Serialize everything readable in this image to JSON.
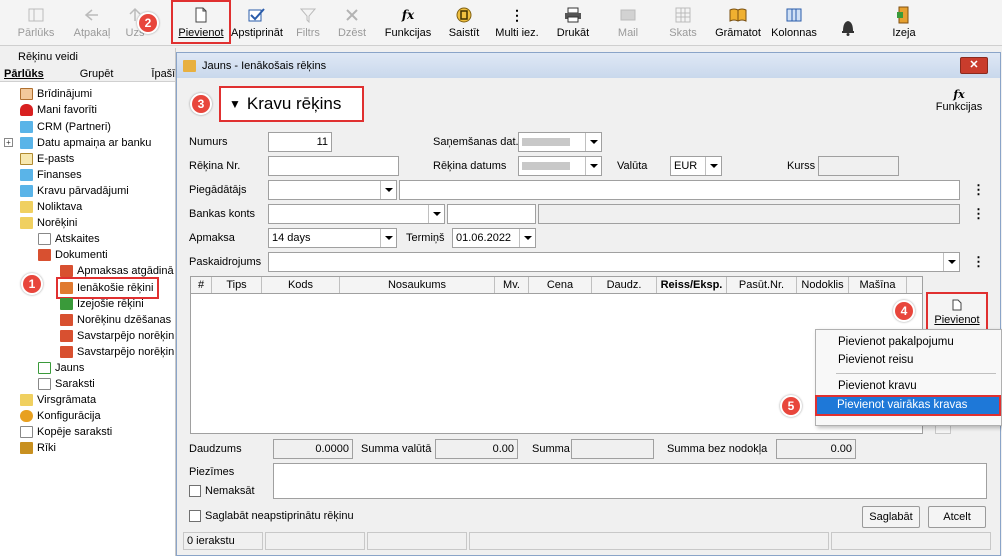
{
  "toolbar": {
    "items": [
      {
        "label": "Pārlūks",
        "icon": "browser-icon",
        "disabled": true
      },
      {
        "label": "Atpakaļ",
        "icon": "back-arrow-icon",
        "disabled": true
      },
      {
        "label": "Uzs",
        "icon": "up-icon",
        "disabled": true
      },
      {
        "label": "Pievienot",
        "icon": "new-document-icon",
        "disabled": false
      },
      {
        "label": "Apstiprināt",
        "icon": "confirm-check-icon",
        "disabled": false
      },
      {
        "label": "Filtrs",
        "icon": "filter-icon",
        "disabled": true
      },
      {
        "label": "Dzēst",
        "icon": "delete-x-icon",
        "disabled": true
      },
      {
        "label": "Funkcijas",
        "icon": "fx-icon",
        "disabled": false
      },
      {
        "label": "Saistīt",
        "icon": "link-icon",
        "disabled": false
      },
      {
        "label": "Multi iez.",
        "icon": "more-vertical-icon",
        "disabled": false
      },
      {
        "label": "Drukāt",
        "icon": "printer-icon",
        "disabled": false
      },
      {
        "label": "Mail",
        "icon": "mail-icon",
        "disabled": true
      },
      {
        "label": "Skats",
        "icon": "grid-view-icon",
        "disabled": true
      },
      {
        "label": "Grāmatot",
        "icon": "book-icon",
        "disabled": false
      },
      {
        "label": "Kolonnas",
        "icon": "columns-icon",
        "disabled": false
      },
      {
        "label": "",
        "icon": "bell-icon",
        "disabled": false
      },
      {
        "label": "Izeja",
        "icon": "exit-door-icon",
        "disabled": false
      }
    ]
  },
  "badges": [
    "1",
    "2",
    "3",
    "4",
    "5"
  ],
  "left_panel": {
    "title": "Rēķinu veidi",
    "tabs": [
      "Pārlūks",
      "Grupēt",
      "Īpašības"
    ],
    "tree": [
      {
        "label": "Brīdinājumi",
        "icon": "home-icon"
      },
      {
        "label": "Mani favorīti",
        "icon": "heart-icon"
      },
      {
        "label": "CRM (Partneri)",
        "icon": "folder-icon"
      },
      {
        "label": "Datu apmaiņa ar banku",
        "icon": "folder-icon"
      },
      {
        "label": "E-pasts",
        "icon": "envelope-icon"
      },
      {
        "label": "Finanses",
        "icon": "folder-icon"
      },
      {
        "label": "Kravu pārvadājumi",
        "icon": "folder-icon"
      },
      {
        "label": "Noliktava",
        "icon": "folder-icon"
      },
      {
        "label": "Norēķini",
        "icon": "folder-icon"
      },
      {
        "label": "Atskaites",
        "icon": "list-icon"
      },
      {
        "label": "Dokumenti",
        "icon": "book-icon"
      },
      {
        "label": "Apmaksas atgādinā",
        "icon": "book-icon"
      },
      {
        "label": "Ienākošie rēķini",
        "icon": "book-icon"
      },
      {
        "label": "Izejošie rēķini",
        "icon": "book-icon"
      },
      {
        "label": "Norēķinu dzēšanas",
        "icon": "book-icon"
      },
      {
        "label": "Savstarpējo norēķin",
        "icon": "book-icon"
      },
      {
        "label": "Savstarpējo norēķin",
        "icon": "book-icon"
      },
      {
        "label": "Jauns",
        "icon": "new-document-icon"
      },
      {
        "label": "Saraksti",
        "icon": "list-icon"
      },
      {
        "label": "Virsgrāmata",
        "icon": "folder-icon"
      },
      {
        "label": "Konfigurācija",
        "icon": "gear-icon"
      },
      {
        "label": "Kopēje saraksti",
        "icon": "list-icon"
      },
      {
        "label": "Rīki",
        "icon": "tools-icon"
      }
    ]
  },
  "window": {
    "title": "Jauns - Ienākošais rēķins",
    "close": "✕",
    "doc_type": "Kravu rēķins",
    "functions_label": "Funkcijas",
    "form": {
      "numurs_label": "Numurs",
      "numurs_value": "11",
      "sanemsanas_label": "Saņemšanas dat.",
      "rekina_nr_label": "Rēķina Nr.",
      "rekina_datums_label": "Rēķina datums",
      "valuta_label": "Valūta",
      "valuta_value": "EUR",
      "kurss_label": "Kurss",
      "piegadatajs_label": "Piegādātājs",
      "bankas_konts_label": "Bankas konts",
      "apmaksa_label": "Apmaksa",
      "apmaksa_value": "14 days",
      "termins_label": "Termiņš",
      "termins_value": "01.06.2022",
      "paskaidrojums_label": "Paskaidrojums"
    },
    "grid_columns": [
      "#",
      "Tips",
      "Kods",
      "Nosaukums",
      "Mv.",
      "Cena",
      "Daudz.",
      "Reiss/Eksp.",
      "Pasūt.Nr.",
      "Nodoklis",
      "Mašīna"
    ],
    "grid_add_label": "Pievienot",
    "totals": {
      "daudzums_label": "Daudzums",
      "daudzums_value": "0.0000",
      "summa_valuta_label": "Summa valūtā",
      "summa_valuta_value": "0.00",
      "summa_label": "Summa",
      "summa_bez_label": "Summa bez nodokļa",
      "summa_bez_value": "0.00"
    },
    "piezimes_label": "Piezīmes",
    "nemaksat_label": "Nemaksāt",
    "save_unconfirmed_label": "Saglabāt neapstiprinātu rēķinu",
    "save_button": "Saglabāt",
    "cancel_button": "Atcelt",
    "status_count": "0 ierakstu"
  },
  "context_menu": [
    "Pievienot pakalpojumu",
    "Pievienot reisu",
    "Pievienot kravu",
    "Pievienot vairākas kravas"
  ]
}
